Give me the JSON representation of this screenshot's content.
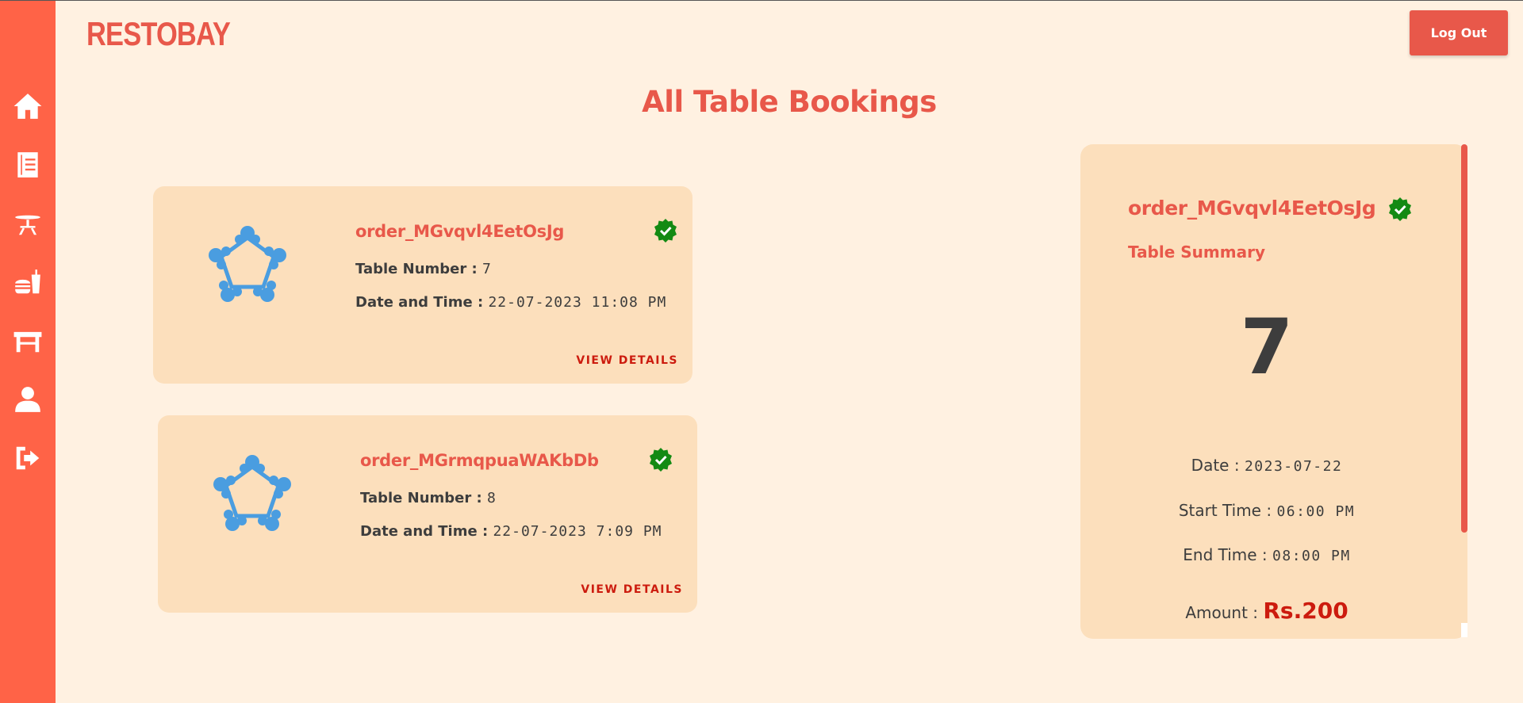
{
  "brand": "RESTOBAY",
  "header": {
    "logout_label": "Log Out"
  },
  "page_title": "All Table Bookings",
  "sidebar": {
    "items": [
      {
        "icon": "home-icon"
      },
      {
        "icon": "menu-book-icon"
      },
      {
        "icon": "dining-table-icon"
      },
      {
        "icon": "food-icon"
      },
      {
        "icon": "table-icon"
      },
      {
        "icon": "user-icon"
      },
      {
        "icon": "logout-icon"
      }
    ]
  },
  "bookings": [
    {
      "order_id": "order_MGvqvl4EetOsJg",
      "table_label": "Table Number : ",
      "table_number": "7",
      "datetime_label": "Date and Time : ",
      "datetime": "22-07-2023 11:08 PM",
      "view_label": "VIEW DETAILS"
    },
    {
      "order_id": "order_MGrmqpuaWAKbDb",
      "table_label": "Table Number : ",
      "table_number": "8",
      "datetime_label": "Date and Time : ",
      "datetime": "22-07-2023 7:09 PM",
      "view_label": "VIEW DETAILS"
    }
  ],
  "summary": {
    "order_id": "order_MGvqvl4EetOsJg",
    "subtitle": "Table Summary",
    "table_number": "7",
    "date_label": "Date : ",
    "date": "2023-07-22",
    "start_label": "Start Time : ",
    "start_time": "06:00 PM",
    "end_label": "End Time : ",
    "end_time": "08:00 PM",
    "amount_label": "Amount : ",
    "amount": "Rs.200"
  },
  "colors": {
    "accent": "#e8584a",
    "sidebar": "#ff6347",
    "card": "#fcdfbc",
    "background": "#fff1e1",
    "verified": "#138a13",
    "table_icon": "#4a9de0"
  }
}
